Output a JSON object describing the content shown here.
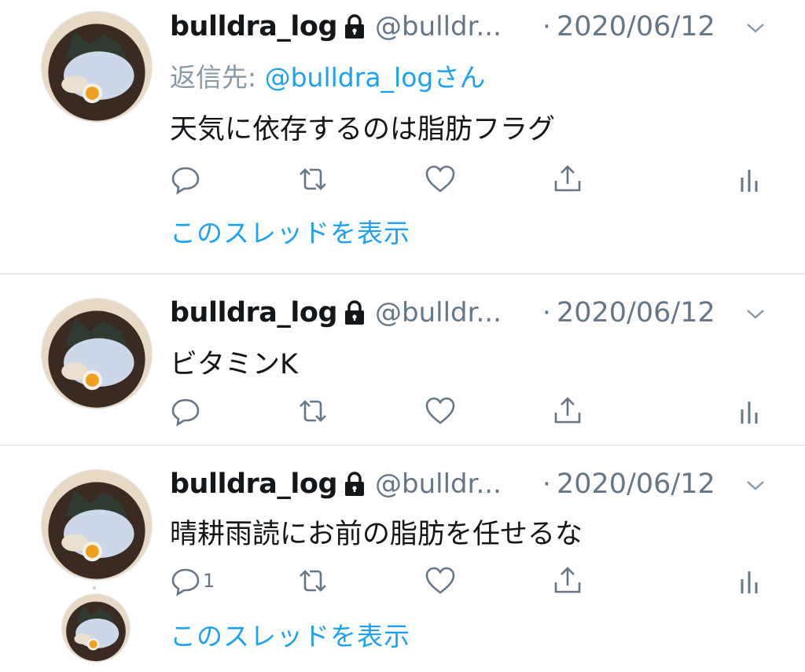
{
  "tweets": [
    {
      "name": "bulldra_log",
      "handle": "@bulldr...",
      "dot": "·",
      "date": "2020/06/12",
      "reply_label": "返信先: ",
      "reply_mention": "@bulldra_logさん",
      "text": "天気に依存するのは脂肪フラグ",
      "reply_count": "",
      "thread_link": "このスレッドを表示"
    },
    {
      "name": "bulldra_log",
      "handle": "@bulldr...",
      "dot": "·",
      "date": "2020/06/12",
      "text": "ビタミンK",
      "reply_count": ""
    },
    {
      "name": "bulldra_log",
      "handle": "@bulldr...",
      "dot": "·",
      "date": "2020/06/12",
      "text": "晴耕雨読にお前の脂肪を任せるな",
      "reply_count": "1",
      "thread_link": "このスレッドを表示"
    }
  ],
  "icons": [
    "avatar",
    "lock-icon",
    "chevron-down-icon",
    "reply-icon",
    "retweet-icon",
    "like-icon",
    "share-icon",
    "analytics-icon"
  ],
  "colors": {
    "link": "#1da1f2",
    "muted": "#657786",
    "text": "#14171a",
    "divider": "#d9d9d9"
  }
}
